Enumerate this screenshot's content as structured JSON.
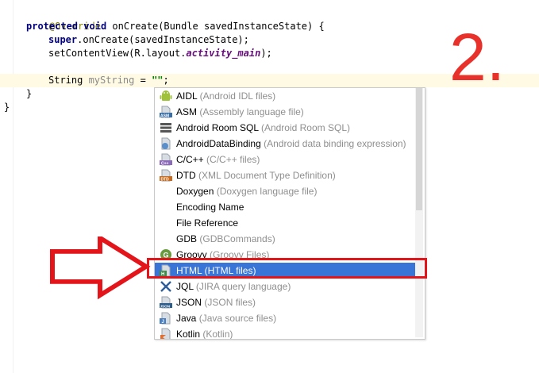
{
  "editor": {
    "line1": {
      "annotation": "@Override"
    },
    "line2": {
      "kw1": "protected",
      "kw2": "void",
      "rest": " onCreate(Bundle savedInstanceState) {"
    },
    "line3": {
      "kw": "super",
      "rest": ".onCreate(savedInstanceState);"
    },
    "line4": {
      "pre": "setContentView(R.layout.",
      "field": "activity_main",
      "post": ");"
    },
    "line5": {
      "type": "String ",
      "var": "myString",
      "eq": " = ",
      "str": "\"\"",
      "end": ";"
    },
    "line6": {
      "text": "}"
    },
    "line7": {
      "text": "}"
    }
  },
  "annotation_label": "2.",
  "completion": {
    "items": [
      {
        "name": "AIDL",
        "desc": "(Android IDL files)",
        "icon": "android-icon"
      },
      {
        "name": "ASM",
        "desc": "(Assembly language file)",
        "icon": "asm-file-icon"
      },
      {
        "name": "Android Room SQL",
        "desc": "(Android Room SQL)",
        "icon": "database-table-icon"
      },
      {
        "name": "AndroidDataBinding",
        "desc": "(Android data binding expression)",
        "icon": "data-binding-file-icon"
      },
      {
        "name": "C/C++",
        "desc": "(C/C++ files)",
        "icon": "cpp-file-icon"
      },
      {
        "name": "DTD",
        "desc": "(XML Document Type Definition)",
        "icon": "dtd-file-icon"
      },
      {
        "name": "Doxygen",
        "desc": "(Doxygen language file)",
        "icon": ""
      },
      {
        "name": "Encoding Name",
        "desc": "",
        "icon": ""
      },
      {
        "name": "File Reference",
        "desc": "",
        "icon": ""
      },
      {
        "name": "GDB",
        "desc": "(GDBCommands)",
        "icon": ""
      },
      {
        "name": "Groovy",
        "desc": "(Groovy Files)",
        "icon": "groovy-icon"
      },
      {
        "name": "HTML",
        "desc": "(HTML files)",
        "icon": "html-file-icon"
      },
      {
        "name": "JQL",
        "desc": "(JIRA query language)",
        "icon": "jql-icon"
      },
      {
        "name": "JSON",
        "desc": "(JSON files)",
        "icon": "json-file-icon"
      },
      {
        "name": "Java",
        "desc": "(Java source files)",
        "icon": "java-file-icon"
      },
      {
        "name": "Kotlin",
        "desc": "(Kotlin)",
        "icon": "kotlin-file-icon"
      }
    ],
    "selected_index": 11
  },
  "colors": {
    "selection": "#3875d7",
    "annotation_red": "#e3151a",
    "current_line": "#fffae3",
    "keyword": "#000080"
  }
}
